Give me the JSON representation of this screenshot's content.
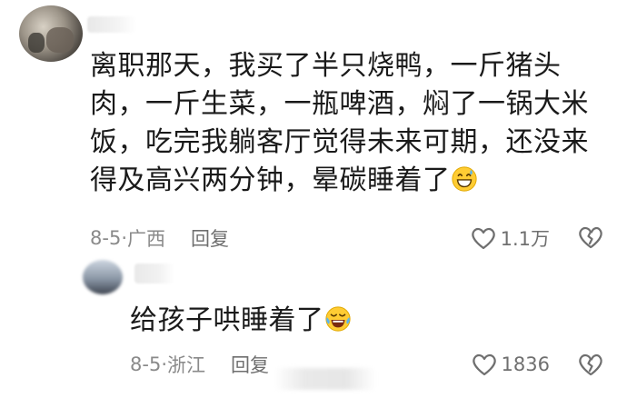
{
  "comments": [
    {
      "text": "离职那天，我买了半只烧鸭，一斤猪头肉，一斤生菜，一瓶啤酒，焖了一锅大米饭，吃完我躺客厅觉得未来可期，还没来得及高兴两分钟，晕碳睡着了",
      "emoji": "grinning-face-with-sweat",
      "date": "8-5",
      "location": "广西",
      "reply_label": "回复",
      "likes": "1.1万"
    },
    {
      "text": "给孩子哄睡着了",
      "emoji": "face-with-tears-of-joy",
      "date": "8-5",
      "location": "浙江",
      "reply_label": "回复",
      "likes": "1836"
    }
  ],
  "separator": "·",
  "colors": {
    "text": "#1a1a1a",
    "meta": "#8a8a8a",
    "icon": "#6f6f6f"
  }
}
